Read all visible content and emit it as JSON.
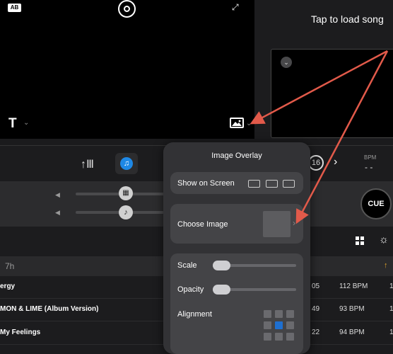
{
  "deck": {
    "load_prompt": "Tap to load song",
    "ab_badge": "AB",
    "text_tool_glyph": "T",
    "expand_icon": "expand-icon",
    "record_icon": "record-icon"
  },
  "toolbar": {
    "icons": [
      "mixer-icon",
      "music-note-icon",
      "more-icon",
      "loop-icon",
      "next-icon"
    ],
    "loop_value": "16",
    "bpm_label": "BPM",
    "bpm_value": "- -"
  },
  "mixer": {
    "cue_label": "CUE"
  },
  "library": {
    "header_time": "7h",
    "rows": [
      {
        "title": "ergy",
        "duration": "05",
        "bpm": "112 BPM",
        "key": "1"
      },
      {
        "title": "MON & LIME (Album Version)",
        "duration": "49",
        "bpm": "93 BPM",
        "key": "1"
      },
      {
        "title": "My Feelings",
        "duration": "22",
        "bpm": "94 BPM",
        "key": "1"
      }
    ]
  },
  "popover": {
    "title": "Image Overlay",
    "show_on_screen_label": "Show on Screen",
    "choose_image_label": "Choose Image",
    "scale_label": "Scale",
    "scale_value": 0,
    "opacity_label": "Opacity",
    "opacity_value": 0,
    "alignment_label": "Alignment",
    "alignment_selected": "center"
  },
  "colors": {
    "accent": "#1e6fd0",
    "annotation_arrow": "#e25a4a",
    "sort_arrow": "#e0a32a"
  }
}
